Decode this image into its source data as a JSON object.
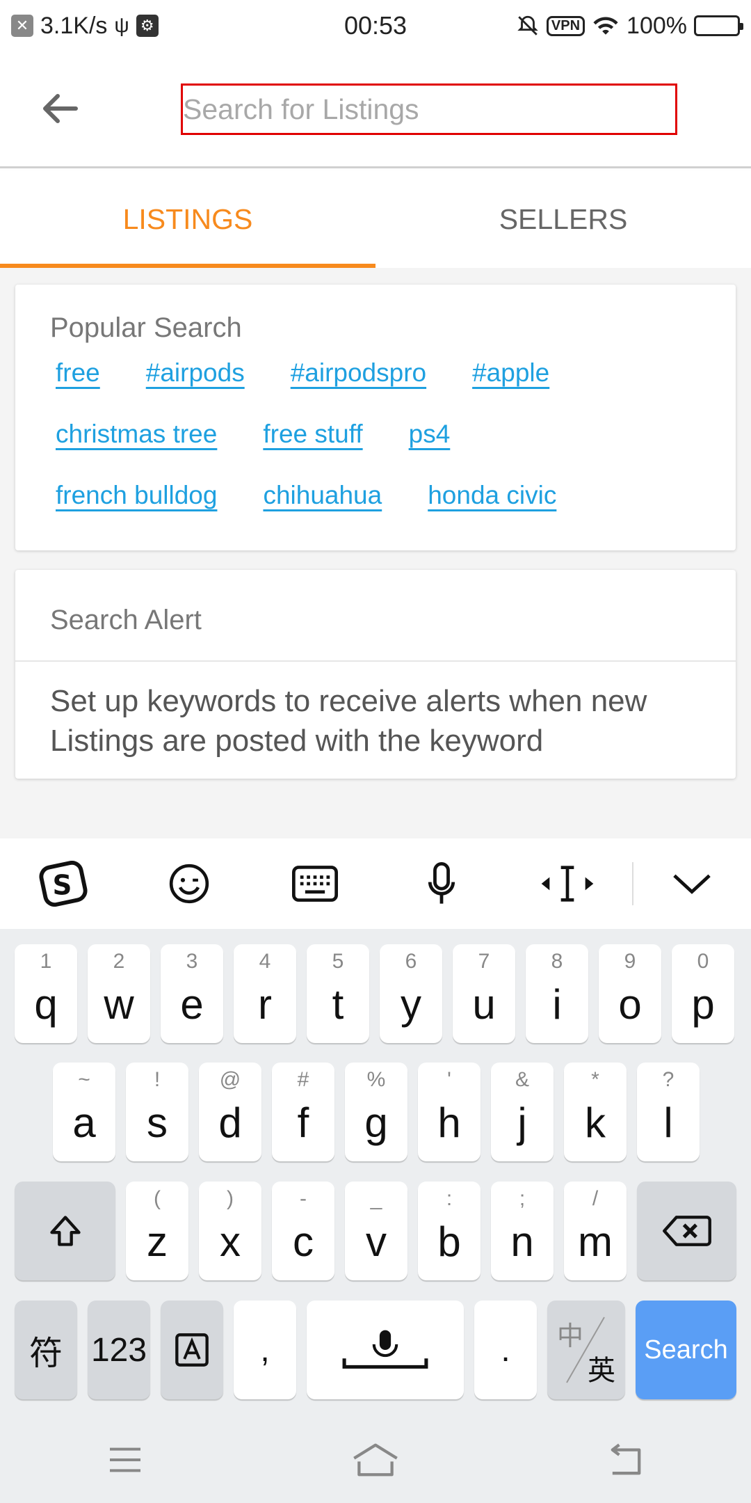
{
  "status_bar": {
    "speed": "3.1K/s",
    "time": "00:53",
    "vpn": "VPN",
    "battery": "100%"
  },
  "header": {
    "search_placeholder": "Search for Listings"
  },
  "tabs": [
    {
      "label": "LISTINGS",
      "active": true
    },
    {
      "label": "SELLERS",
      "active": false
    }
  ],
  "popular": {
    "title": "Popular Search",
    "rows": [
      [
        "free",
        "#airpods",
        "#airpodspro",
        "#apple"
      ],
      [
        "christmas tree",
        "free stuff",
        "ps4"
      ],
      [
        "french bulldog",
        "chihuahua",
        "honda civic"
      ]
    ]
  },
  "alert": {
    "title": "Search Alert",
    "text": "Set up keywords to receive alerts when new Listings are posted with the keyword"
  },
  "keyboard": {
    "row1": [
      {
        "ch": "q",
        "sub": "1"
      },
      {
        "ch": "w",
        "sub": "2"
      },
      {
        "ch": "e",
        "sub": "3"
      },
      {
        "ch": "r",
        "sub": "4"
      },
      {
        "ch": "t",
        "sub": "5"
      },
      {
        "ch": "y",
        "sub": "6"
      },
      {
        "ch": "u",
        "sub": "7"
      },
      {
        "ch": "i",
        "sub": "8"
      },
      {
        "ch": "o",
        "sub": "9"
      },
      {
        "ch": "p",
        "sub": "0"
      }
    ],
    "row2": [
      {
        "ch": "a",
        "sub": "~"
      },
      {
        "ch": "s",
        "sub": "!"
      },
      {
        "ch": "d",
        "sub": "@"
      },
      {
        "ch": "f",
        "sub": "#"
      },
      {
        "ch": "g",
        "sub": "%"
      },
      {
        "ch": "h",
        "sub": "'"
      },
      {
        "ch": "j",
        "sub": "&"
      },
      {
        "ch": "k",
        "sub": "*"
      },
      {
        "ch": "l",
        "sub": "?"
      }
    ],
    "row3": [
      {
        "ch": "z",
        "sub": "("
      },
      {
        "ch": "x",
        "sub": ")"
      },
      {
        "ch": "c",
        "sub": "-"
      },
      {
        "ch": "v",
        "sub": "_"
      },
      {
        "ch": "b",
        "sub": ":"
      },
      {
        "ch": "n",
        "sub": ";"
      },
      {
        "ch": "m",
        "sub": "/"
      }
    ],
    "sym_label": "符",
    "num_label": "123",
    "comma": ",",
    "period": ".",
    "lang_top": "中",
    "lang_bottom": "英",
    "search_label": "Search"
  }
}
